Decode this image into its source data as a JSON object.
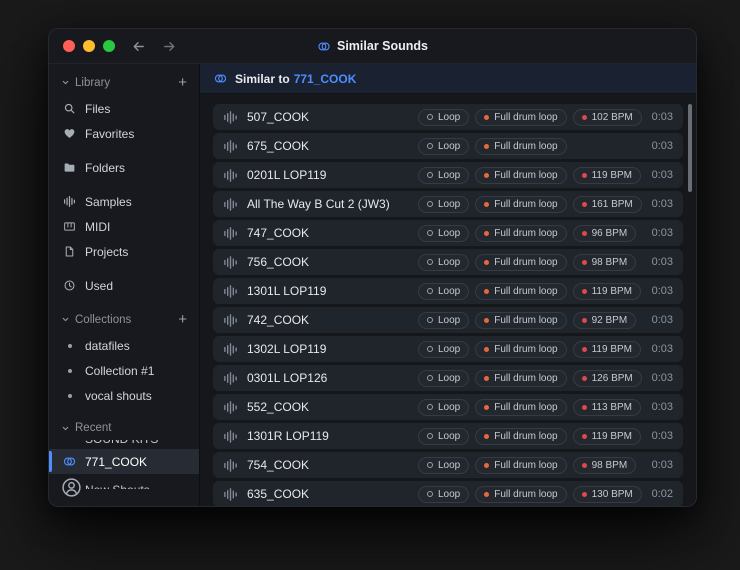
{
  "window": {
    "title": "Similar Sounds"
  },
  "ui": {
    "add_label": "+"
  },
  "colors": {
    "accent": "#4d8dff",
    "drum_dot": "#e8683e",
    "bpm_dot": "#e0484f",
    "traffic_red": "#ff5f57",
    "traffic_yellow": "#febc2e",
    "traffic_green": "#28c840"
  },
  "sidebar": {
    "sections": [
      {
        "label": "Library",
        "add_button": true,
        "items": [
          {
            "icon": "search-icon",
            "label": "Files"
          },
          {
            "icon": "heart-icon",
            "label": "Favorites"
          },
          {
            "icon": "folder-icon",
            "label": "Folders",
            "gap": true
          },
          {
            "icon": "samples-icon",
            "label": "Samples",
            "gap": true
          },
          {
            "icon": "midi-icon",
            "label": "MIDI"
          },
          {
            "icon": "document-icon",
            "label": "Projects"
          },
          {
            "icon": "clock-icon",
            "label": "Used",
            "gap": true
          }
        ]
      },
      {
        "label": "Collections",
        "add_button": true,
        "items": [
          {
            "icon": "dot-icon",
            "label": "datafiles"
          },
          {
            "icon": "dot-icon",
            "label": "Collection #1"
          },
          {
            "icon": "dot-icon",
            "label": "vocal shouts"
          }
        ]
      },
      {
        "label": "Recent",
        "add_button": false,
        "items": [
          {
            "icon": null,
            "label": "SOUND KITS",
            "clipped": "top"
          },
          {
            "icon": "similar-icon",
            "label": "771_COOK",
            "selected": true
          },
          {
            "icon": null,
            "label": "New Shouts",
            "clipped": "bottom"
          }
        ]
      }
    ]
  },
  "main": {
    "header": {
      "prefix": "Similar to",
      "target": "771_COOK"
    },
    "rows": [
      {
        "name": "507_COOK",
        "tags": [
          {
            "kind": "loop",
            "label": "Loop"
          },
          {
            "kind": "drum",
            "label": "Full drum loop"
          },
          {
            "kind": "bpm",
            "label": "102 BPM"
          }
        ],
        "duration": "0:03"
      },
      {
        "name": "675_COOK",
        "tags": [
          {
            "kind": "loop",
            "label": "Loop"
          },
          {
            "kind": "drum",
            "label": "Full drum loop"
          }
        ],
        "duration": "0:03"
      },
      {
        "name": "0201L LOP119",
        "tags": [
          {
            "kind": "loop",
            "label": "Loop"
          },
          {
            "kind": "drum",
            "label": "Full drum loop"
          },
          {
            "kind": "bpm",
            "label": "119 BPM"
          }
        ],
        "duration": "0:03"
      },
      {
        "name": "All The Way B Cut 2 (JW3)",
        "tags": [
          {
            "kind": "loop",
            "label": "Loop"
          },
          {
            "kind": "drum",
            "label": "Full drum loop"
          },
          {
            "kind": "bpm",
            "label": "161 BPM"
          }
        ],
        "duration": "0:03"
      },
      {
        "name": "747_COOK",
        "tags": [
          {
            "kind": "loop",
            "label": "Loop"
          },
          {
            "kind": "drum",
            "label": "Full drum loop"
          },
          {
            "kind": "bpm",
            "label": "96 BPM"
          }
        ],
        "duration": "0:03"
      },
      {
        "name": "756_COOK",
        "tags": [
          {
            "kind": "loop",
            "label": "Loop"
          },
          {
            "kind": "drum",
            "label": "Full drum loop"
          },
          {
            "kind": "bpm",
            "label": "98 BPM"
          }
        ],
        "duration": "0:03"
      },
      {
        "name": "1301L LOP119",
        "tags": [
          {
            "kind": "loop",
            "label": "Loop"
          },
          {
            "kind": "drum",
            "label": "Full drum loop"
          },
          {
            "kind": "bpm",
            "label": "119 BPM"
          }
        ],
        "duration": "0:03"
      },
      {
        "name": "742_COOK",
        "tags": [
          {
            "kind": "loop",
            "label": "Loop"
          },
          {
            "kind": "drum",
            "label": "Full drum loop"
          },
          {
            "kind": "bpm",
            "label": "92 BPM"
          }
        ],
        "duration": "0:03"
      },
      {
        "name": "1302L LOP119",
        "tags": [
          {
            "kind": "loop",
            "label": "Loop"
          },
          {
            "kind": "drum",
            "label": "Full drum loop"
          },
          {
            "kind": "bpm",
            "label": "119 BPM"
          }
        ],
        "duration": "0:03"
      },
      {
        "name": "0301L LOP126",
        "tags": [
          {
            "kind": "loop",
            "label": "Loop"
          },
          {
            "kind": "drum",
            "label": "Full drum loop"
          },
          {
            "kind": "bpm",
            "label": "126 BPM"
          }
        ],
        "duration": "0:03"
      },
      {
        "name": "552_COOK",
        "tags": [
          {
            "kind": "loop",
            "label": "Loop"
          },
          {
            "kind": "drum",
            "label": "Full drum loop"
          },
          {
            "kind": "bpm",
            "label": "113 BPM"
          }
        ],
        "duration": "0:03"
      },
      {
        "name": "1301R LOP119",
        "tags": [
          {
            "kind": "loop",
            "label": "Loop"
          },
          {
            "kind": "drum",
            "label": "Full drum loop"
          },
          {
            "kind": "bpm",
            "label": "119 BPM"
          }
        ],
        "duration": "0:03"
      },
      {
        "name": "754_COOK",
        "tags": [
          {
            "kind": "loop",
            "label": "Loop"
          },
          {
            "kind": "drum",
            "label": "Full drum loop"
          },
          {
            "kind": "bpm",
            "label": "98 BPM"
          }
        ],
        "duration": "0:03"
      },
      {
        "name": "635_COOK",
        "tags": [
          {
            "kind": "loop",
            "label": "Loop"
          },
          {
            "kind": "drum",
            "label": "Full drum loop"
          },
          {
            "kind": "bpm",
            "label": "130 BPM"
          }
        ],
        "duration": "0:02"
      }
    ]
  }
}
